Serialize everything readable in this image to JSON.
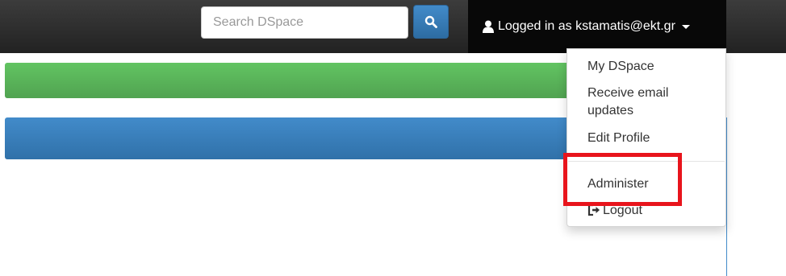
{
  "navbar": {
    "search": {
      "placeholder": "Search DSpace",
      "button_icon": "search-icon"
    },
    "user": {
      "label": "Logged in as kstamatis@ekt.gr",
      "icon": "user-icon",
      "caret_icon": "caret-down-icon"
    }
  },
  "dropdown": {
    "items": [
      {
        "label": "My DSpace"
      },
      {
        "label": "Receive email updates"
      },
      {
        "label": "Edit Profile"
      },
      {
        "label": "Administer"
      },
      {
        "label": "Logout",
        "icon": "logout-icon"
      }
    ]
  },
  "colors": {
    "navbar": "#222222",
    "search_button": "#428bca",
    "green_banner": "#5cb85c",
    "blue_banner": "#428bca",
    "highlight": "#e8141c"
  }
}
